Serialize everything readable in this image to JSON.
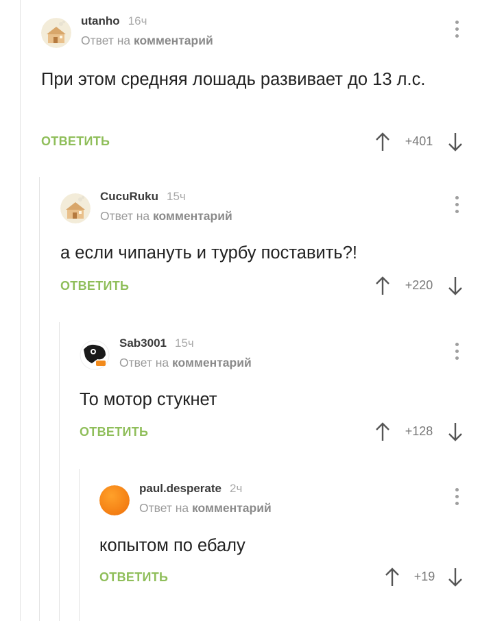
{
  "comments": [
    {
      "username": "utanho",
      "time": "16ч",
      "reply_prefix": "Ответ на",
      "reply_link": "комментарий",
      "text": "При этом средняя лошадь развивает до 13 л.с.",
      "reply_label": "ОТВЕТИТЬ",
      "score": "+401",
      "avatar": "house-avatar"
    },
    {
      "username": "CucuRuku",
      "time": "15ч",
      "reply_prefix": "Ответ на",
      "reply_link": "комментарий",
      "text": "а если чипануть и турбу поставить?!",
      "reply_label": "ОТВЕТИТЬ",
      "score": "+220",
      "avatar": "house-avatar"
    },
    {
      "username": "Sab3001",
      "time": "15ч",
      "reply_prefix": "Ответ на",
      "reply_link": "комментарий",
      "text": "То мотор стукнет",
      "reply_label": "ОТВЕТИТЬ",
      "score": "+128",
      "avatar": "cartoon-avatar"
    },
    {
      "username": "paul.desperate",
      "time": "2ч",
      "reply_prefix": "Ответ на",
      "reply_link": "комментарий",
      "text": "копытом по ебалу",
      "reply_label": "ОТВЕТИТЬ",
      "score": "+19",
      "avatar": "orange-circle-avatar"
    }
  ],
  "colors": {
    "reply": "#8fbe5a",
    "thread_line": "#e3e3e3",
    "avatar_orange": "#f7941d"
  }
}
